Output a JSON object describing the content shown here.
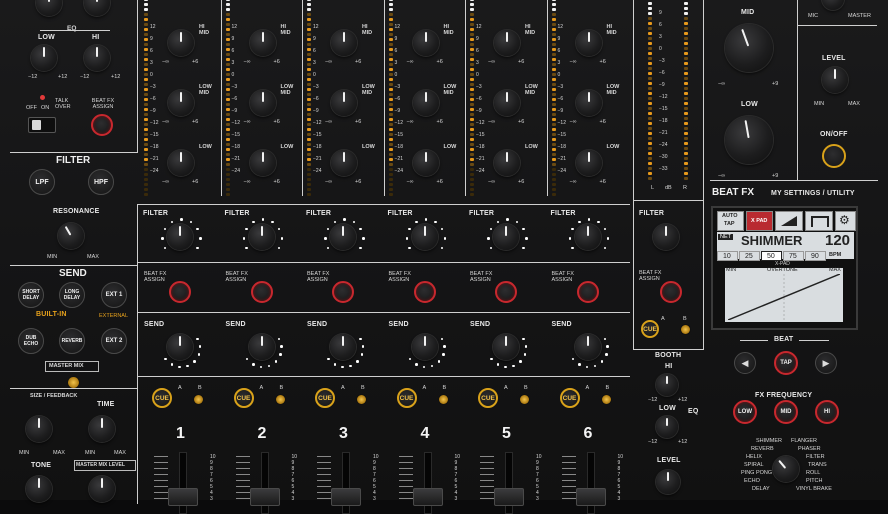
{
  "left": {
    "eq_label": "EQ",
    "low": "LOW",
    "hi": "HI",
    "m12a": "−12",
    "p12a": "+12",
    "m12b": "−12",
    "p12b": "+12",
    "off": "OFF",
    "on": "ON",
    "talk_over": "TALK OVER",
    "beat_fx_assign": "BEAT FX ASSIGN",
    "filter": "FILTER",
    "lpf": "LPF",
    "hpf": "HPF",
    "resonance": "RESONANCE",
    "min": "MIN",
    "max": "MAX",
    "send": "SEND",
    "short_delay": "SHORT DELAY",
    "long_delay": "LONG DELAY",
    "ext1": "EXT 1",
    "built_in": "BUILT-IN",
    "external": "EXTERNAL",
    "dub_echo": "DUB ECHO",
    "reverb": "REVERB",
    "ext2": "EXT 2",
    "master_mix": "MASTER MIX",
    "size_feedback": "SIZE / FEEDBACK",
    "time": "TIME",
    "min2": "MIN",
    "max2": "MAX",
    "min3": "MIN",
    "max3": "MAX",
    "tone": "TONE",
    "master_mix_level": "MASTER MIX LEVEL"
  },
  "channels": [
    {
      "num": "1",
      "hi_mid": "HI MID",
      "low_mid": "LOW MID",
      "low": "LOW",
      "filter": "FILTER",
      "bfx": "BEAT FX ASSIGN",
      "send": "SEND",
      "cue": "CUE",
      "a": "A",
      "b": "B"
    },
    {
      "num": "2",
      "hi_mid": "HI MID",
      "low_mid": "LOW MID",
      "low": "LOW",
      "filter": "FILTER",
      "bfx": "BEAT FX ASSIGN",
      "send": "SEND",
      "cue": "CUE",
      "a": "A",
      "b": "B"
    },
    {
      "num": "3",
      "hi_mid": "HI MID",
      "low_mid": "LOW MID",
      "low": "LOW",
      "filter": "FILTER",
      "bfx": "BEAT FX ASSIGN",
      "send": "SEND",
      "cue": "CUE",
      "a": "A",
      "b": "B"
    },
    {
      "num": "4",
      "hi_mid": "HI MID",
      "low_mid": "LOW MID",
      "low": "LOW",
      "filter": "FILTER",
      "bfx": "BEAT FX ASSIGN",
      "send": "SEND",
      "cue": "CUE",
      "a": "A",
      "b": "B"
    },
    {
      "num": "5",
      "hi_mid": "HI MID",
      "low_mid": "LOW MID",
      "low": "LOW",
      "filter": "FILTER",
      "bfx": "BEAT FX ASSIGN",
      "send": "SEND",
      "cue": "CUE",
      "a": "A",
      "b": "B"
    },
    {
      "num": "6",
      "hi_mid": "HI MID",
      "low_mid": "LOW MID",
      "low": "LOW",
      "filter": "FILTER",
      "bfx": "BEAT FX ASSIGN",
      "send": "SEND",
      "cue": "CUE",
      "a": "A",
      "b": "B"
    }
  ],
  "knob_scale": {
    "neg_inf": "−∞",
    "plus6": "+6"
  },
  "meter_scale": [
    "12",
    "9",
    "6",
    "3",
    "0",
    "−3",
    "−6",
    "−9",
    "−12",
    "−15",
    "−18",
    "−21",
    "−24"
  ],
  "master_meter_scale": [
    "9",
    "6",
    "3",
    "0",
    "−3",
    "−6",
    "−9",
    "−12",
    "−15",
    "−18",
    "−21",
    "−24",
    "−30",
    "−33"
  ],
  "master_meter": {
    "l": "L",
    "db": "dB",
    "r": "R"
  },
  "fader_scale": [
    "10",
    "9",
    "8",
    "7",
    "6",
    "5",
    "4",
    "3",
    "2",
    "1",
    "0"
  ],
  "master": {
    "mic": "MIC",
    "master": "MASTER",
    "mid": "MID",
    "low": "LOW",
    "neg_inf": "−∞",
    "plus9": "+9",
    "neg_inf2": "−∞",
    "plus9b": "+9",
    "level": "LEVEL",
    "min": "MIN",
    "max": "MAX",
    "onoff": "ON/OFF",
    "filter": "FILTER",
    "bfx": "BEAT FX ASSIGN",
    "cue": "CUE",
    "a": "A",
    "b": "B"
  },
  "beatfx": {
    "title": "BEAT FX",
    "settings": "MY SETTINGS / UTILITY",
    "auto": "AUTO",
    "tap": "TAP",
    "xpad_label": "X PAD",
    "fx_name": "SHIMMER",
    "bpm": "120",
    "bpm_unit": "BPM",
    "beats": [
      "10",
      "25",
      "50",
      "75",
      "90"
    ],
    "selected_beat": "50",
    "x_pad": "X-PAD",
    "min": "MIN",
    "overtone": "OVERTONE",
    "max": "MAX",
    "beat": "BEAT",
    "tap_btn": "TAP",
    "fx_frequency": "FX FREQUENCY",
    "low": "LOW",
    "mid": "MID",
    "hi": "HI",
    "fx_list_left": [
      "SHIMMER",
      "REVERB",
      "HELIX",
      "SPIRAL",
      "PING PONG",
      "ECHO",
      "DELAY"
    ],
    "fx_list_right": [
      "FLANGER",
      "PHASER",
      "FILTER",
      "TRANS",
      "ROLL",
      "PITCH",
      "VINYL BRAKE"
    ]
  },
  "booth": {
    "title": "BOOTH",
    "hi": "HI",
    "low": "LOW",
    "eq": "EQ",
    "m12": "−12",
    "p12": "+12",
    "m12b": "−12",
    "p12b": "+12",
    "level": "LEVEL"
  },
  "colors": {
    "accent_red": "#c8282e",
    "accent_yellow": "#d9a21a",
    "meter_amber": "#e89a1c",
    "meter_white": "#f2f2f2"
  }
}
